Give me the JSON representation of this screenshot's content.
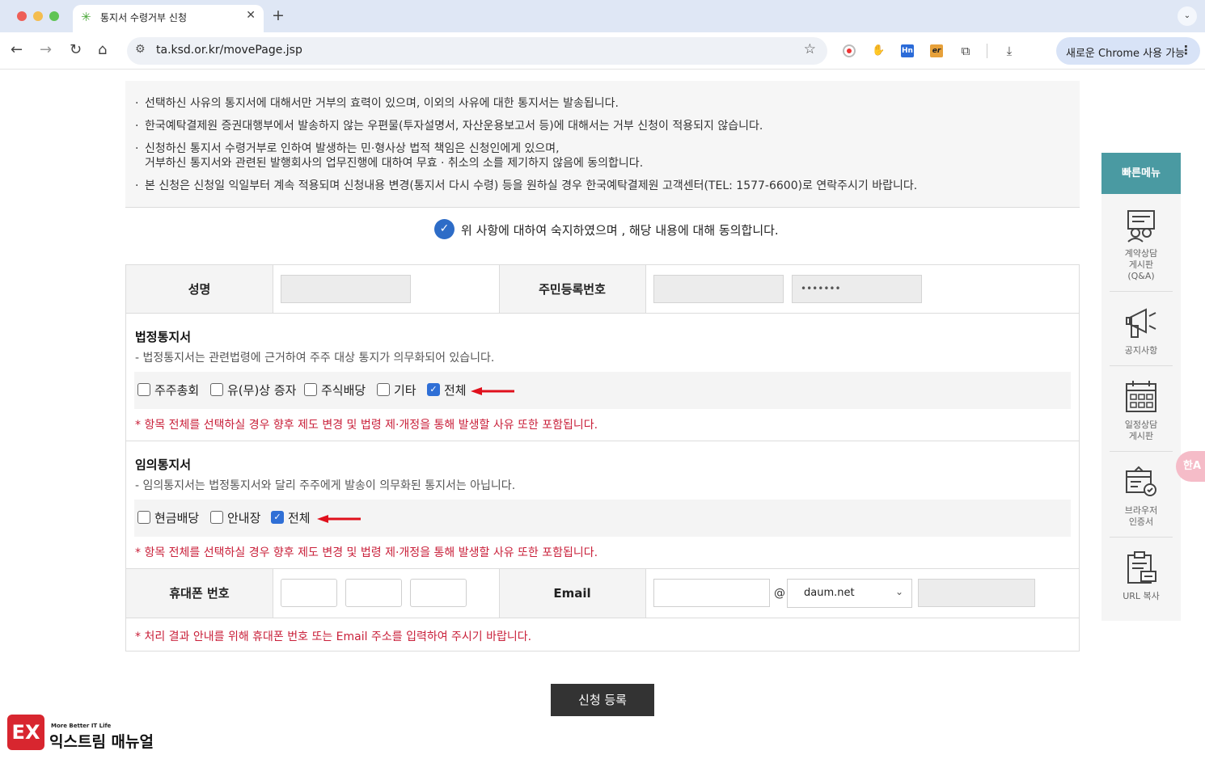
{
  "browser": {
    "tab_title": "통지서 수령거부 신청",
    "tab_close": "✕",
    "new_tab": "+",
    "url": "ta.ksd.or.kr/movePage.jsp",
    "update_label": "새로운 Chrome 사용 가능",
    "update_menu": "⋮",
    "ext_hn": "Hn",
    "ext_er": "er"
  },
  "notice": {
    "bullet": "·",
    "items": [
      "선택하신 사유의 통지서에 대해서만 거부의 효력이 있으며, 이외의 사유에 대한 통지서는 발송됩니다.",
      "한국예탁결제원 증권대행부에서 발송하지 않는 우편물(투자설명서, 자산운용보고서 등)에 대해서는 거부 신청이 적용되지 않습니다.",
      "신청하신 통지서 수령거부로 인하여 발생하는 민·형사상 법적 책임은 신청인에게 있으며,\n거부하신 통지서와 관련된 발행회사의 업무진행에 대하여 무효 · 취소의 소를 제기하지 않음에 동의합니다.",
      "본 신청은 신청일 익일부터 계속 적용되며 신청내용 변경(통지서 다시 수령) 등을 원하실 경우 한국예탁결제원 고객센터(TEL: 1577-6600)로 연락주시기 바랍니다."
    ]
  },
  "agree": {
    "text": "위 사항에 대하여 숙지하였으며 , 해당 내용에 대해 동의합니다.",
    "checked": true
  },
  "form": {
    "name_label": "성명",
    "rrn_label": "주민등록번호",
    "rrn_masked": "•••••••",
    "legal": {
      "title": "법정통지서",
      "desc": "- 법정통지서는 관련법령에 근거하여 주주 대상 통지가 의무화되어 있습니다.",
      "options": [
        {
          "label": "주주총회",
          "checked": false
        },
        {
          "label": "유(무)상 증자",
          "checked": false
        },
        {
          "label": "주식배당",
          "checked": false
        },
        {
          "label": "기타",
          "checked": false
        },
        {
          "label": "전체",
          "checked": true
        }
      ],
      "warning": "* 항목 전체를 선택하실 경우 향후 제도 변경 및 법령 제·개정을 통해 발생할 사유 또한 포함됩니다."
    },
    "voluntary": {
      "title": "임의통지서",
      "desc": "- 임의통지서는 법정통지서와 달리 주주에게 발송이 의무화된 통지서는 아닙니다.",
      "options": [
        {
          "label": "현금배당",
          "checked": false
        },
        {
          "label": "안내장",
          "checked": false
        },
        {
          "label": "전체",
          "checked": true
        }
      ],
      "warning": "* 항목 전체를 선택하실 경우 향후 제도 변경 및 법령 제·개정을 통해 발생할 사유 또한 포함됩니다."
    },
    "phone_label": "휴대폰 번호",
    "email_label": "Email",
    "email_at": "@",
    "email_domain": "daum.net",
    "contact_warning": "* 처리 결과 안내를 위해 휴대폰 번호 또는 Email 주소를 입력하여 주시기 바랍니다."
  },
  "submit_label": "신청 등록",
  "quick_menu": {
    "title": "빠른메뉴",
    "items": [
      {
        "label": "계약상담\n게시판\n(Q&A)",
        "icon": "consult-board-icon"
      },
      {
        "label": "공지사항",
        "icon": "megaphone-icon"
      },
      {
        "label": "일정상담\n게시판",
        "icon": "calendar-icon"
      },
      {
        "label": "브라우저\n인증서",
        "icon": "certificate-icon"
      },
      {
        "label": "URL 복사",
        "icon": "clipboard-icon"
      }
    ]
  },
  "translate_fab": "한A",
  "watermark": {
    "mark": "EX",
    "tagline": "More Better IT Life",
    "name": "익스트림 매뉴얼"
  },
  "colors": {
    "accent": "#2f6fd6",
    "warning": "#c9203a",
    "quick_head": "#4a9aa2",
    "submit": "#333333"
  }
}
